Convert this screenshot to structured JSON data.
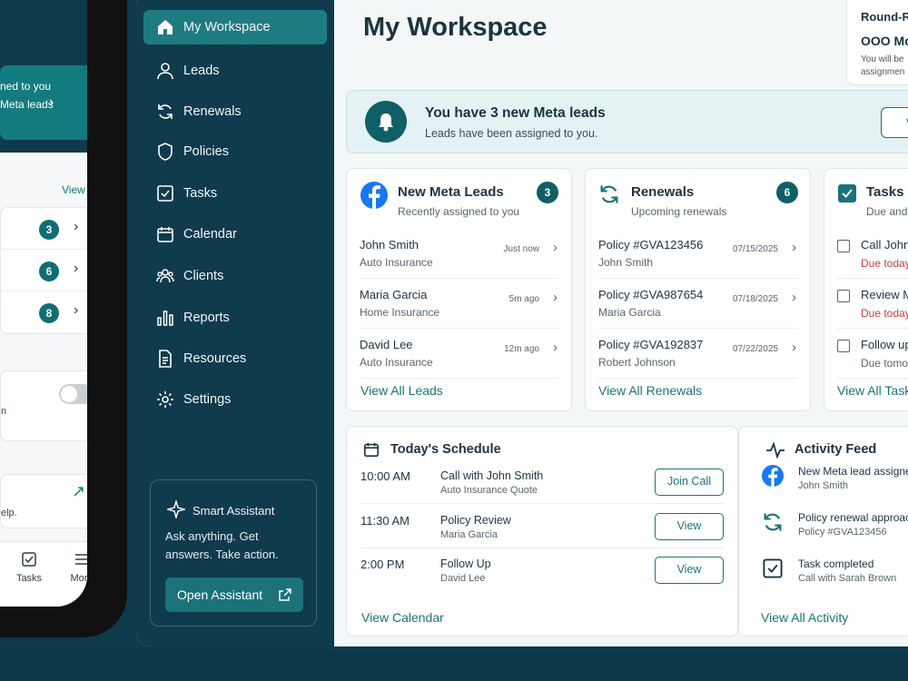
{
  "phone": {
    "banner_line1": "ned to you",
    "banner_line2": "Meta leads",
    "view_all": "View All",
    "rows": [
      {
        "count": "3"
      },
      {
        "count": "6"
      },
      {
        "count": "8"
      }
    ],
    "toggle_text": "n",
    "help_text": "elp.",
    "tabs": [
      {
        "label": "Tasks"
      },
      {
        "label": "More"
      }
    ]
  },
  "sidebar": {
    "items": [
      {
        "label": "My Workspace",
        "icon": "home-icon"
      },
      {
        "label": "Leads",
        "icon": "user-icon"
      },
      {
        "label": "Renewals",
        "icon": "refresh-icon"
      },
      {
        "label": "Policies",
        "icon": "shield-icon"
      },
      {
        "label": "Tasks",
        "icon": "checkbox-icon"
      },
      {
        "label": "Calendar",
        "icon": "calendar-icon"
      },
      {
        "label": "Clients",
        "icon": "users-icon"
      },
      {
        "label": "Reports",
        "icon": "bar-chart-icon"
      },
      {
        "label": "Resources",
        "icon": "document-icon"
      },
      {
        "label": "Settings",
        "icon": "gear-icon"
      }
    ],
    "assistant": {
      "title": "Smart Assistant",
      "description": "Ask anything. Get answers. Take action.",
      "button": "Open Assistant"
    }
  },
  "header": {
    "title": "My Workspace",
    "rr_title": "Round-R",
    "rr_value": "OOO Mo",
    "rr_line1": "You will be",
    "rr_line2": "assignmen"
  },
  "notification": {
    "title": "You have 3 new Meta leads",
    "subtitle": "Leads have been assigned to you.",
    "button": "V"
  },
  "leads_card": {
    "title": "New Meta Leads",
    "subtitle": "Recently assigned to you",
    "count": "3",
    "rows": [
      {
        "name": "John Smith",
        "type": "Auto Insurance",
        "time": "Just now"
      },
      {
        "name": "Maria Garcia",
        "type": "Home Insurance",
        "time": "5m ago"
      },
      {
        "name": "David Lee",
        "type": "Auto Insurance",
        "time": "12m ago"
      }
    ],
    "link": "View All Leads"
  },
  "renewals_card": {
    "title": "Renewals",
    "subtitle": "Upcoming renewals",
    "count": "6",
    "rows": [
      {
        "policy": "Policy #GVA123456",
        "client": "John Smith",
        "date": "07/15/2025"
      },
      {
        "policy": "Policy #GVA987654",
        "client": "Maria Garcia",
        "date": "07/18/2025"
      },
      {
        "policy": "Policy #GVA192837",
        "client": "Robert Johnson",
        "date": "07/22/2025"
      }
    ],
    "link": "View All Renewals"
  },
  "tasks_card": {
    "title": "Tasks",
    "subtitle": "Due and",
    "rows": [
      {
        "name": "Call John",
        "due": "Due today"
      },
      {
        "name": "Review M",
        "due": "Due today"
      },
      {
        "name": "Follow up",
        "due": "Due tomor"
      }
    ],
    "link": "View All Task"
  },
  "schedule_card": {
    "title": "Today's Schedule",
    "rows": [
      {
        "time": "10:00 AM",
        "title": "Call with John Smith",
        "detail": "Auto Insurance Quote",
        "action": "Join Call"
      },
      {
        "time": "11:30 AM",
        "title": "Policy Review",
        "detail": "Maria Garcia",
        "action": "View"
      },
      {
        "time": "2:00 PM",
        "title": "Follow Up",
        "detail": "David Lee",
        "action": "View"
      }
    ],
    "link": "View Calendar"
  },
  "activity_card": {
    "title": "Activity Feed",
    "rows": [
      {
        "title": "New Meta lead assigne",
        "detail": "John Smith",
        "icon": "facebook-icon"
      },
      {
        "title": "Policy renewal approac",
        "detail": "Policy #GVA123456",
        "icon": "refresh-icon"
      },
      {
        "title": "Task completed",
        "detail": "Call with Sarah Brown",
        "icon": "checkbox-icon"
      }
    ],
    "link": "View All Activity"
  },
  "colors": {
    "sidebar": "#0f3b4d",
    "accent": "#1b7279",
    "badge": "#0f5f67",
    "due_today": "#d23b3b"
  }
}
